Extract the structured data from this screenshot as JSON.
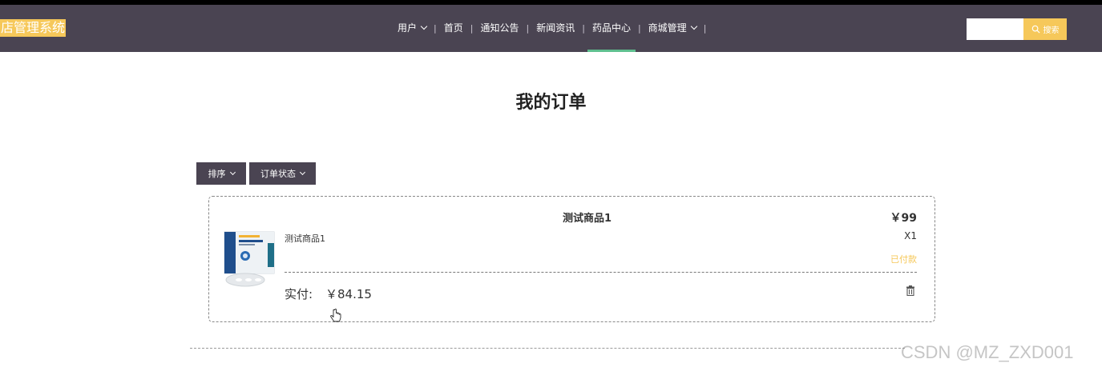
{
  "header": {
    "brand": "店管理系统",
    "nav": [
      {
        "label": "用户",
        "dropdown": true,
        "active": false
      },
      {
        "label": "首页",
        "dropdown": false,
        "active": false
      },
      {
        "label": "通知公告",
        "dropdown": false,
        "active": false
      },
      {
        "label": "新闻资讯",
        "dropdown": false,
        "active": false
      },
      {
        "label": "药品中心",
        "dropdown": false,
        "active": true
      },
      {
        "label": "商城管理",
        "dropdown": true,
        "active": false
      }
    ],
    "search": {
      "placeholder": "",
      "button_label": "搜索",
      "icon": "search-icon"
    }
  },
  "page": {
    "title": "我的订单",
    "filters": {
      "sort_label": "排序",
      "status_label": "订单状态"
    }
  },
  "order": {
    "title": "测试商品1",
    "price": "￥99",
    "product_name": "测试商品1",
    "quantity": "X1",
    "status": "已付款",
    "paid_label": "实付:",
    "paid_value": "￥84.15",
    "delete_icon": "trash-icon"
  },
  "watermark": "CSDN @MZ_ZXD001",
  "colors": {
    "navbar": "#4a4452",
    "accent_yellow": "#f6c85a",
    "active_underline": "#5fbf8f"
  }
}
